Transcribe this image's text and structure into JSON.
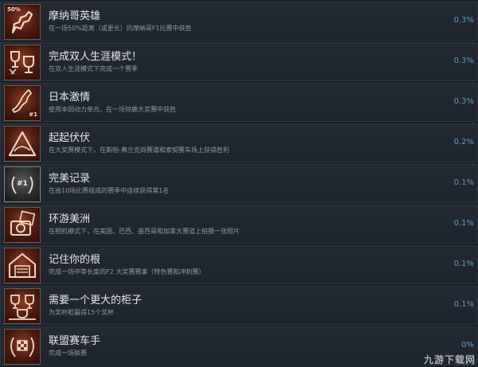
{
  "achievements": [
    {
      "icon": "monaco-track-icon",
      "badge": "50%",
      "title": "摩纳哥英雄",
      "desc": "在一场50%距离（或更长）的摩纳哥F1比赛中获胜",
      "pct": "0.3%"
    },
    {
      "icon": "trophies-icon",
      "badge": "",
      "title": "完成双人生涯模式！",
      "desc": "在双人生涯模式下完成一个赛季",
      "pct": "0.3%"
    },
    {
      "icon": "japan-map-icon",
      "badge": "#1",
      "title": "日本激情",
      "desc": "使用本田动力单元，在一场铃鹿大奖赛中获胜",
      "pct": "0.3%"
    },
    {
      "icon": "hill-warning-icon",
      "badge": "",
      "title": "起起伏伏",
      "desc": "在大奖赛模式下，在斯帕-弗兰克尚赛道和索契赛车场上获得胜利",
      "pct": "0.2%"
    },
    {
      "icon": "laurel-first-icon",
      "badge": "#1",
      "title": "完美记录",
      "desc": "在由10场比赛组成的赛季中连续获得第1名",
      "pct": "0.1%"
    },
    {
      "icon": "camera-photos-icon",
      "badge": "",
      "title": "环游美洲",
      "desc": "在相机模式下，在美国、巴西、墨西哥和加拿大赛道上拍摄一张照片",
      "pct": "0.1%"
    },
    {
      "icon": "garage-f2-icon",
      "badge": "",
      "title": "记住你的根",
      "desc": "完成一场中等长度的F2 大奖赛赛事（特色赛和冲刺赛）",
      "pct": "0.1%"
    },
    {
      "icon": "trophy-cabinet-icon",
      "badge": "",
      "title": "需要一个更大的柜子",
      "desc": "为奖杯柜赢得15个奖杯",
      "pct": "0.1%"
    },
    {
      "icon": "checkered-laurel-icon",
      "badge": "",
      "title": "联盟赛车手",
      "desc": "完成一场联赛",
      "pct": "0%"
    }
  ],
  "watermark": "九游下载网",
  "colors": {
    "percent": "#5f9cc6",
    "title": "#e6e8ea",
    "desc": "#8f98a2",
    "icon_bg": "#6b2714"
  }
}
